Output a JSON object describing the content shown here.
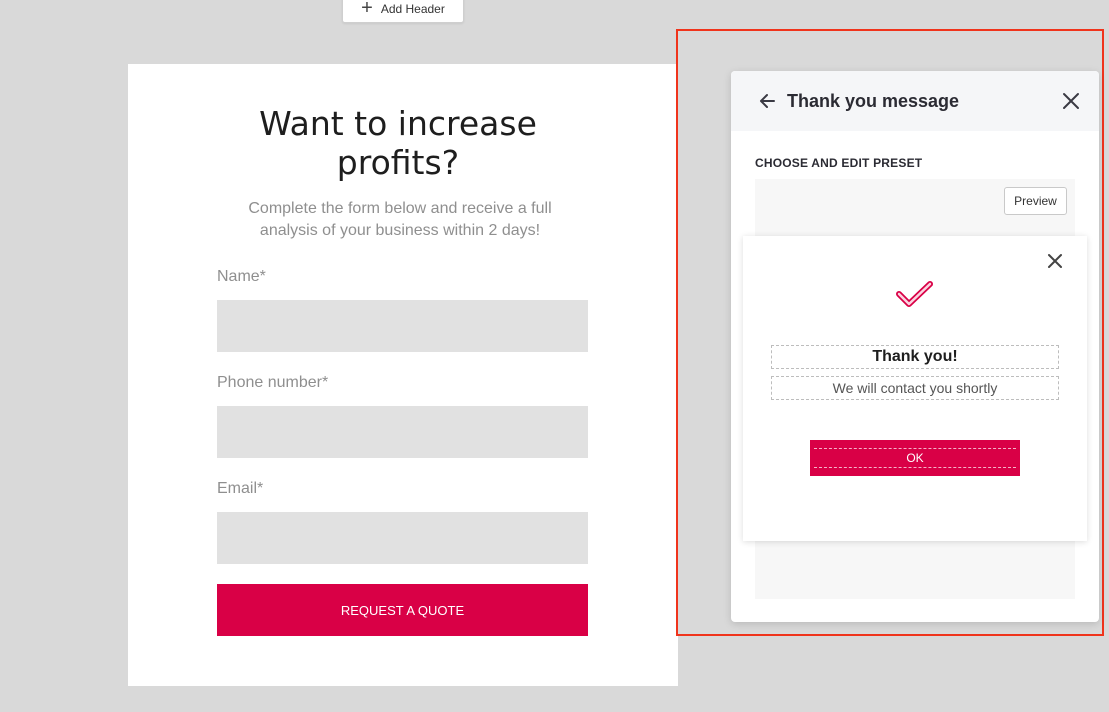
{
  "toolbar": {
    "add_header_label": "Add Header"
  },
  "form": {
    "title": "Want to increase profits?",
    "subtitle": "Complete the form below and receive a full analysis of your business within 2 days!",
    "fields": [
      {
        "label": "Name*",
        "value": ""
      },
      {
        "label": "Phone number*",
        "value": ""
      },
      {
        "label": "Email*",
        "value": ""
      }
    ],
    "submit_label": "REQUEST A QUOTE"
  },
  "panel": {
    "title": "Thank you message",
    "section_label": "CHOOSE AND EDIT PRESET",
    "preview_label": "Preview"
  },
  "thank_you": {
    "title": "Thank you!",
    "text": "We will contact you shortly",
    "button_label": "OK"
  },
  "colors": {
    "accent": "#d90046",
    "highlight": "#f0341c",
    "canvas": "#d9d9d9"
  }
}
